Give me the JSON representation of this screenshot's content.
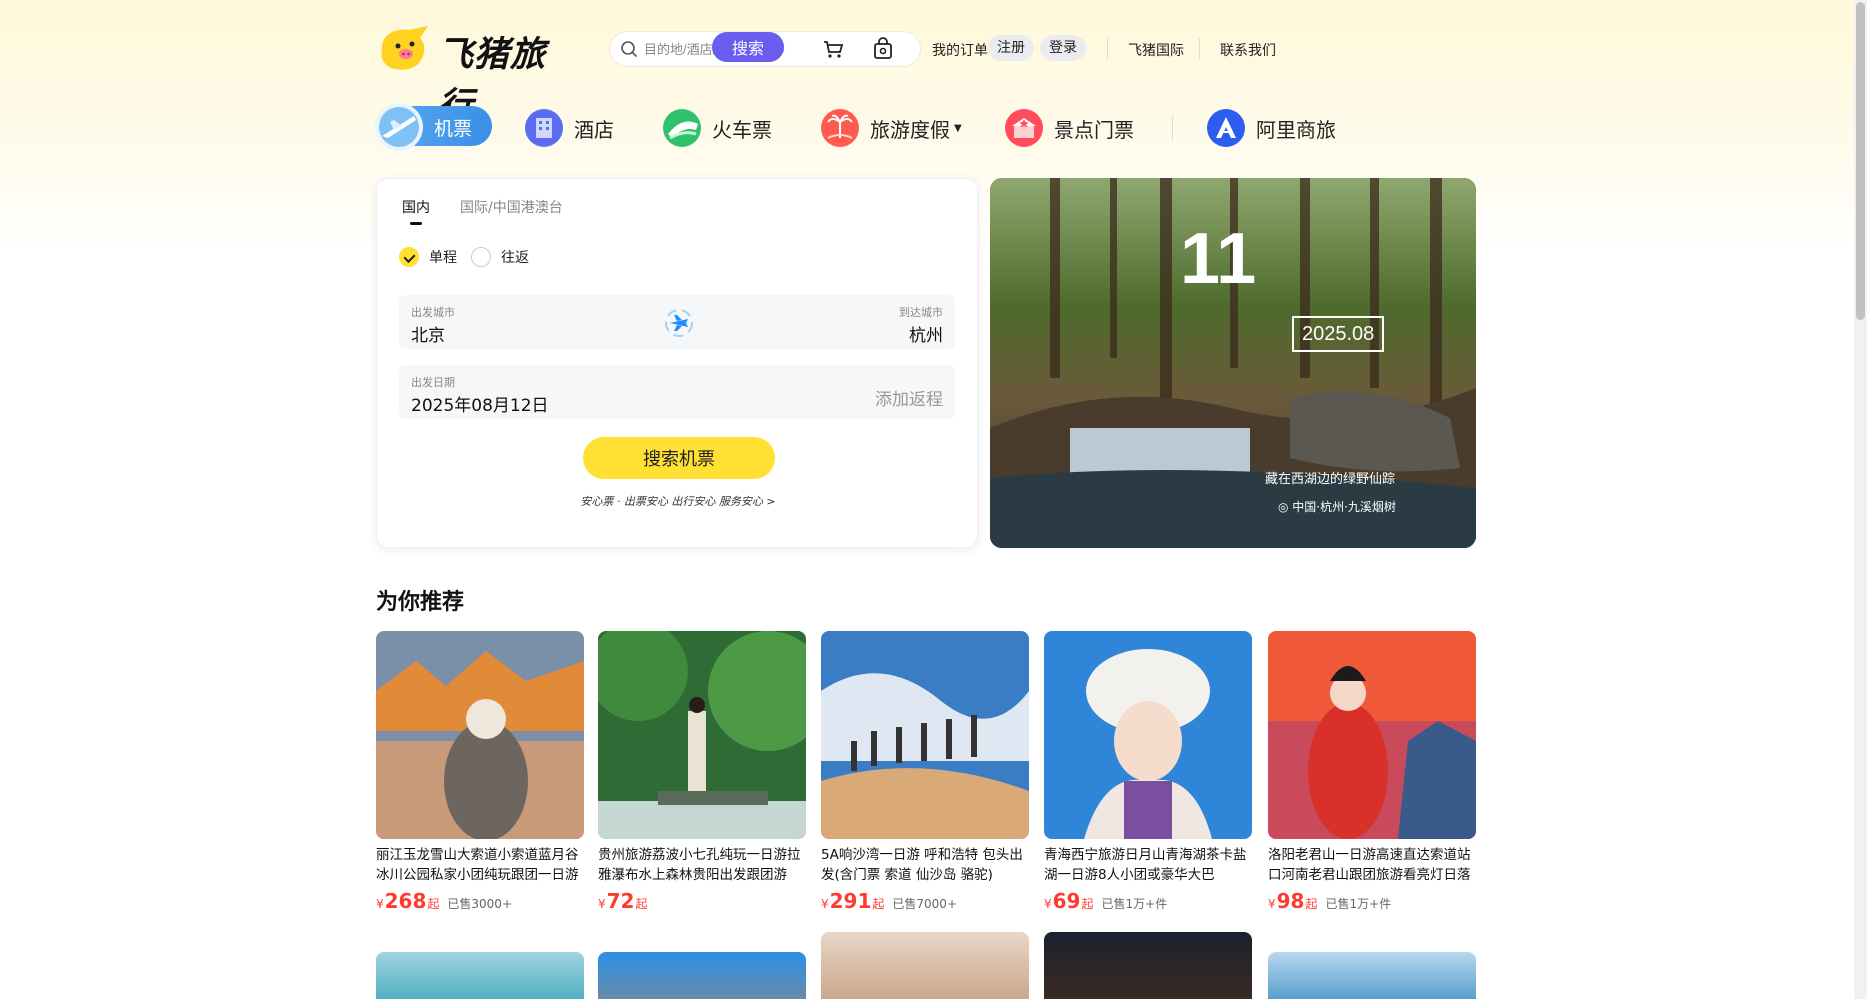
{
  "header": {
    "logo_text": "飞猪旅行",
    "search_placeholder": "目的地/酒店/景点/签证等",
    "search_button": "搜索",
    "my_orders": "我的订单",
    "register": "注册",
    "login": "登录",
    "international": "飞猪国际",
    "contact": "联系我们"
  },
  "nav": {
    "flights": "机票",
    "hotels": "酒店",
    "trains": "火车票",
    "vacation": "旅游度假",
    "tickets": "景点门票",
    "business": "阿里商旅"
  },
  "flight_search": {
    "tab_domestic": "国内",
    "tab_international": "国际/中国港澳台",
    "one_way": "单程",
    "round_trip": "往返",
    "from_label": "出发城市",
    "from_value": "北京",
    "to_label": "到达城市",
    "to_value": "杭州",
    "date_label": "出发日期",
    "date_value": "2025年08月12日",
    "add_return": "添加返程",
    "search_button": "搜索机票",
    "assurance": "安心票 · 出票安心 出行安心 服务安心  >"
  },
  "hero": {
    "day": "11",
    "month": "2025.08",
    "caption": "藏在西湖边的绿野仙踪",
    "location": "◎ 中国·杭州·九溪烟树"
  },
  "recommend": {
    "title": "为你推荐",
    "items": [
      {
        "title": "丽江玉龙雪山大索道小索道蓝月谷冰川公园私家小团纯玩跟团一日游",
        "currency": "¥",
        "price": "268",
        "suffix": "起",
        "sold": "已售3000+"
      },
      {
        "title": "贵州旅游荔波小七孔纯玩一日游拉雅瀑布水上森林贵阳出发跟团游",
        "currency": "¥",
        "price": "72",
        "suffix": "起",
        "sold": ""
      },
      {
        "title": "5A响沙湾一日游 呼和浩特 包头出发(含门票 索道 仙沙岛 骆驼)",
        "currency": "¥",
        "price": "291",
        "suffix": "起",
        "sold": "已售7000+"
      },
      {
        "title": "青海西宁旅游日月山青海湖茶卡盐湖一日游8人小团或豪华大巴",
        "currency": "¥",
        "price": "69",
        "suffix": "起",
        "sold": "已售1万+件"
      },
      {
        "title": "洛阳老君山一日游高速直达索道站口河南老君山跟团旅游看亮灯日落",
        "currency": "¥",
        "price": "98",
        "suffix": "起",
        "sold": "已售1万+件"
      }
    ]
  },
  "icons": {
    "cart": "cart-icon",
    "bag": "bag-icon",
    "search": "search-icon",
    "swap": "plane-swap-icon"
  },
  "colors": {
    "brand_yellow": "#ffe033",
    "search_purple": "#6b5cf0",
    "price_red": "#ff3b30",
    "nav_active_blue": "#3a8fe6"
  }
}
